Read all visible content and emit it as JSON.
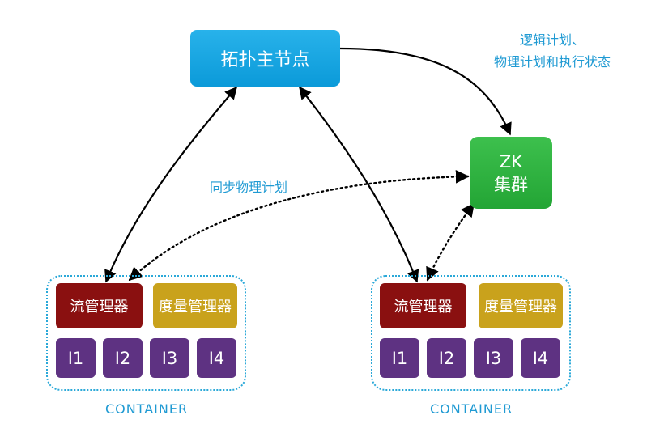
{
  "topology_master": {
    "label": "拓扑主节点"
  },
  "zk_cluster": {
    "line1": "ZK",
    "line2": "集群"
  },
  "annotations": {
    "plan_state_line1": "逻辑计划、",
    "plan_state_line2": "物理计划和执行状态",
    "sync_plan": "同步物理计划"
  },
  "containers": [
    {
      "label": "CONTAINER",
      "stream_manager": "流管理器",
      "metrics_manager": "度量管理器",
      "instances": [
        "I1",
        "I2",
        "I3",
        "I4"
      ]
    },
    {
      "label": "CONTAINER",
      "stream_manager": "流管理器",
      "metrics_manager": "度量管理器",
      "instances": [
        "I1",
        "I2",
        "I3",
        "I4"
      ]
    }
  ],
  "colors": {
    "accent_blue": "#1f9ad3",
    "topo_blue": "#0b9ad9",
    "zk_green": "#23a535",
    "stream_red": "#8a1010",
    "metrics_gold": "#c9a21c",
    "instance_purple": "#5e3282"
  }
}
